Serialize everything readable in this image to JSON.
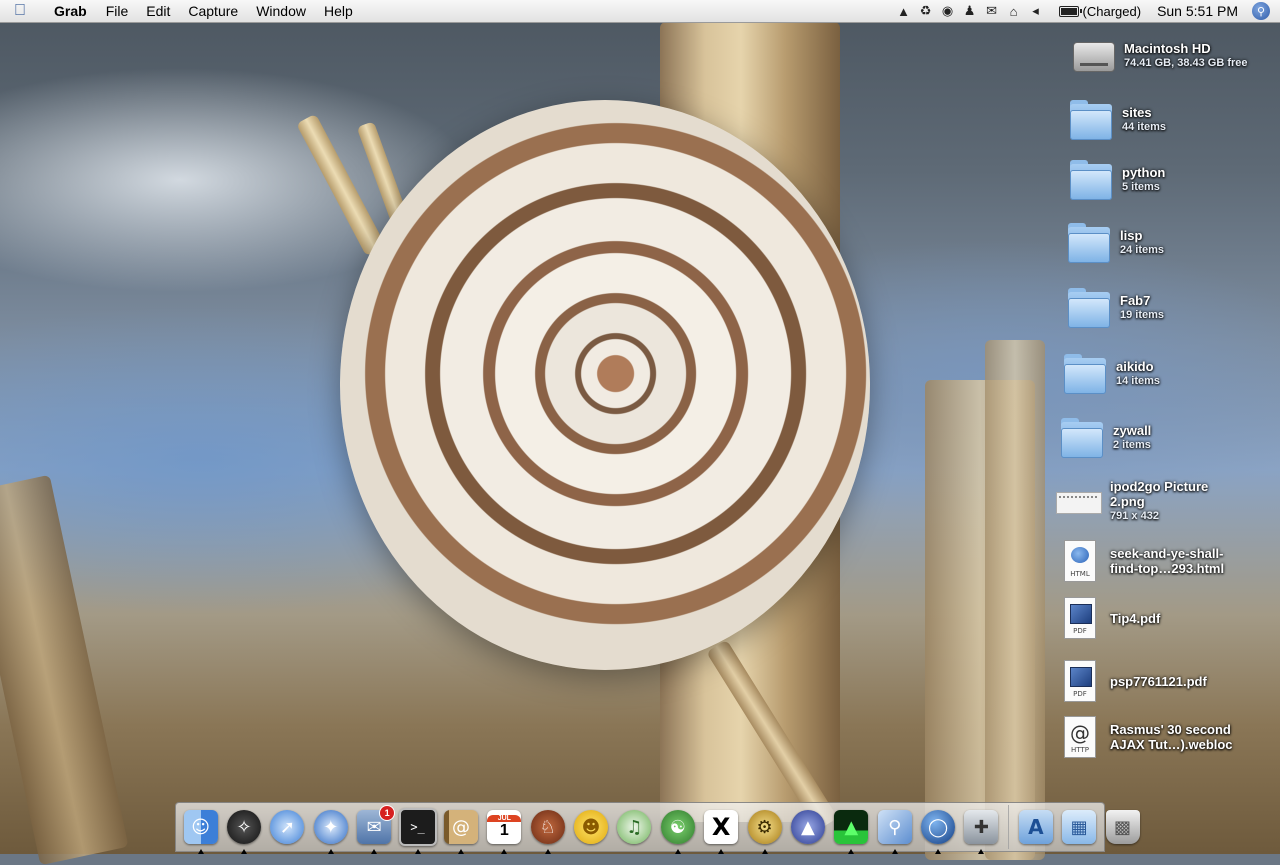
{
  "menubar": {
    "app_name": "Grab",
    "menus": [
      "File",
      "Edit",
      "Capture",
      "Window",
      "Help"
    ],
    "battery_status": "(Charged)",
    "battery_level": 1.0,
    "clock": "Sun 5:51 PM",
    "status_icons": [
      "growl-icon",
      "sync-icon",
      "spiral-icon",
      "person-icon",
      "mail-icon",
      "wifi-icon",
      "volume-icon"
    ]
  },
  "desktop": {
    "items": [
      {
        "name": "Macintosh HD",
        "info": "74.41 GB, 38.43 GB free",
        "icon": "hard-drive-icon"
      },
      {
        "name": "sites",
        "info": "44 items",
        "icon": "folder-icon"
      },
      {
        "name": "python",
        "info": "5 items",
        "icon": "folder-icon"
      },
      {
        "name": "lisp",
        "info": "24 items",
        "icon": "folder-icon"
      },
      {
        "name": "Fab7",
        "info": "19 items",
        "icon": "folder-icon"
      },
      {
        "name": "aikido",
        "info": "14 items",
        "icon": "folder-icon"
      },
      {
        "name": "zywall",
        "info": "2 items",
        "icon": "folder-icon"
      },
      {
        "name": "ipod2go Picture\n2.png",
        "info": "791 x 432",
        "icon": "png-file-icon"
      },
      {
        "name": "seek-and-ye-shall-\nfind-top…293.html",
        "info": "",
        "icon": "html-file-icon",
        "label": "HTML"
      },
      {
        "name": "Tip4.pdf",
        "info": "",
        "icon": "pdf-file-icon",
        "label": "PDF"
      },
      {
        "name": "psp7761121.pdf",
        "info": "",
        "icon": "pdf-file-icon",
        "label": "PDF"
      },
      {
        "name": "Rasmus' 30 second\nAJAX Tut…).webloc",
        "info": "",
        "icon": "webloc-file-icon",
        "label": "HTTP"
      }
    ]
  },
  "dock": {
    "mail_badge": "1",
    "calendar_month": "JUL",
    "calendar_day": "1",
    "terminal_prompt": ">_",
    "x11_label": "X",
    "apps": [
      {
        "name": "finder-icon",
        "color": "#3c7fd8",
        "running": true
      },
      {
        "name": "dashboard-icon",
        "color": "#2b2b2b",
        "running": true
      },
      {
        "name": "safari-icon",
        "color": "#4a8fe0",
        "running": false
      },
      {
        "name": "network-utility-icon",
        "color": "#2f6cc4",
        "running": true
      },
      {
        "name": "mail-icon",
        "color": "#6a8db8",
        "running": true,
        "badge": true
      },
      {
        "name": "terminal-icon",
        "color": "#222222",
        "running": true
      },
      {
        "name": "address-book-icon",
        "color": "#b08a4c",
        "running": true
      },
      {
        "name": "ical-icon",
        "color": "#ffffff",
        "running": true
      },
      {
        "name": "gnu-icon",
        "color": "#8a3a1e",
        "running": true
      },
      {
        "name": "adium-icon",
        "color": "#f2c31e",
        "running": false
      },
      {
        "name": "itunes-icon",
        "color": "#6fb35a",
        "running": false
      },
      {
        "name": "gecko-icon",
        "color": "#3f9a3a",
        "running": true
      },
      {
        "name": "x11-icon",
        "color": "#ffffff",
        "running": true
      },
      {
        "name": "activity-gear-icon",
        "color": "#c69a2a",
        "running": true
      },
      {
        "name": "vlc-icon",
        "color": "#3a4fa8",
        "running": false
      },
      {
        "name": "activity-monitor-icon",
        "color": "#0d3b12",
        "running": true
      },
      {
        "name": "preview-icon",
        "color": "#5d8ed0",
        "running": true
      },
      {
        "name": "google-earth-icon",
        "color": "#1d5fb0",
        "running": true
      },
      {
        "name": "grab-icon",
        "color": "#9aa3ad",
        "running": true
      }
    ],
    "right_items": [
      {
        "name": "applications-folder-icon",
        "color": "#7fb0e4"
      },
      {
        "name": "documents-stack-icon",
        "color": "#9ec3ea"
      },
      {
        "name": "trash-icon",
        "color": "#c8c8c8"
      }
    ]
  }
}
